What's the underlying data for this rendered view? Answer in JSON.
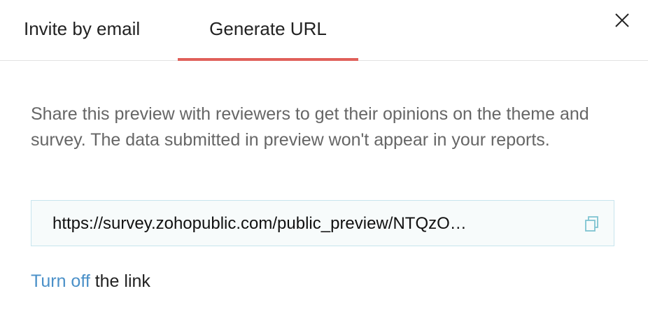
{
  "tabs": [
    {
      "label": "Invite by email",
      "active": false
    },
    {
      "label": "Generate URL",
      "active": true
    }
  ],
  "icons": {
    "close": "close-icon",
    "copy": "copy-icon"
  },
  "description": "Share this preview with reviewers to get their opinions on the theme and survey. The data submitted in preview won't appear in your reports.",
  "url": {
    "value": "https://survey.zohopublic.com/public_preview/NTQzO…"
  },
  "footer": {
    "link_label": "Turn off",
    "suffix": " the link"
  },
  "colors": {
    "active_tab_underline": "#e0605a",
    "link": "#4a90c8",
    "url_box_border": "#c7e5ee",
    "description_text": "#666666"
  }
}
